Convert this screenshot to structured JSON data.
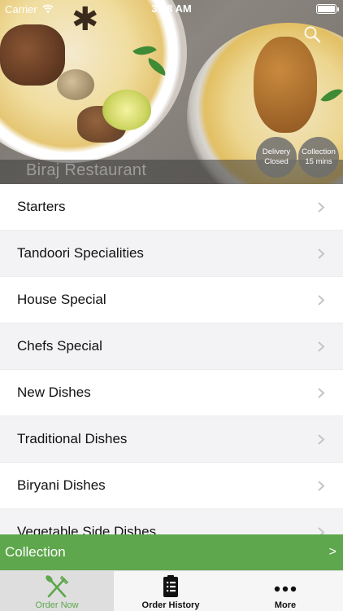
{
  "status_bar": {
    "carrier": "Carrier",
    "time": "3:18 AM"
  },
  "hero": {
    "restaurant_name": "Biraj Restaurant",
    "delivery_badge": {
      "line1": "Delivery",
      "line2": "Closed"
    },
    "collection_badge": {
      "line1": "Collection",
      "line2": "15 mins"
    }
  },
  "menu": {
    "items": [
      {
        "label": "Starters"
      },
      {
        "label": "Tandoori Specialities"
      },
      {
        "label": "House Special"
      },
      {
        "label": "Chefs Special"
      },
      {
        "label": "New Dishes"
      },
      {
        "label": "Traditional Dishes"
      },
      {
        "label": "Biryani Dishes"
      },
      {
        "label": "Vegetable Side Dishes"
      }
    ]
  },
  "collection_bar": {
    "label": "Collection",
    "arrow": ">"
  },
  "tab_bar": {
    "tabs": [
      {
        "label": "Order Now",
        "icon": "fork-knife-icon",
        "active": true
      },
      {
        "label": "Order History",
        "icon": "receipt-icon",
        "active": false
      },
      {
        "label": "More",
        "icon": "more-dots-icon",
        "active": false
      }
    ]
  },
  "colors": {
    "accent_green": "#5ea74c",
    "list_alt_row": "#f3f3f5",
    "tab_active_bg": "#dedede"
  }
}
